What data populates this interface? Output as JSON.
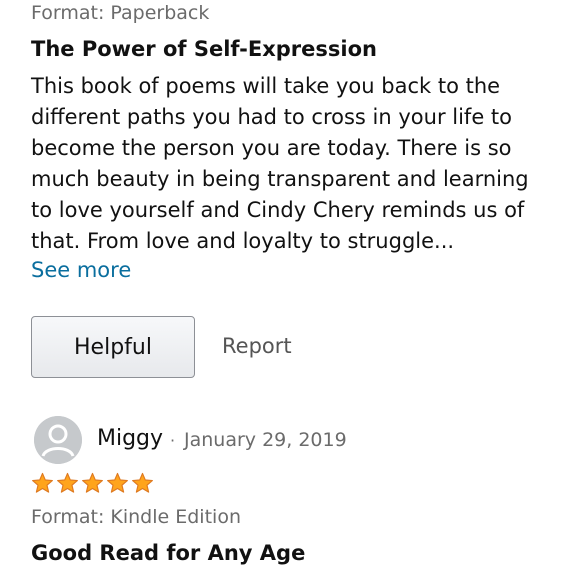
{
  "review1": {
    "format": "Format: Paperback",
    "title": "The Power of Self-Expression",
    "lines": [
      "This book of poems will take you back to the",
      "different paths you had to cross in your life to",
      "become the person you are today. There is so",
      "much beauty in being transparent and learning",
      "to love yourself and Cindy Chery reminds us of",
      "that. From love and loyalty to struggle..."
    ],
    "see_more": "See more",
    "helpful_label": "Helpful",
    "report_label": "Report"
  },
  "review2": {
    "reviewer": "Miggy",
    "separator": "·",
    "date": "January 29, 2019",
    "rating": 5,
    "format": "Format: Kindle Edition",
    "title": "Good Read for Any Age"
  },
  "colors": {
    "star": "#ffa41c",
    "star_outline": "#de7921",
    "link": "#0a6e9e",
    "avatar": "#c6c9cc"
  },
  "icons": {
    "avatar": "user-avatar-icon",
    "star": "star-icon"
  }
}
